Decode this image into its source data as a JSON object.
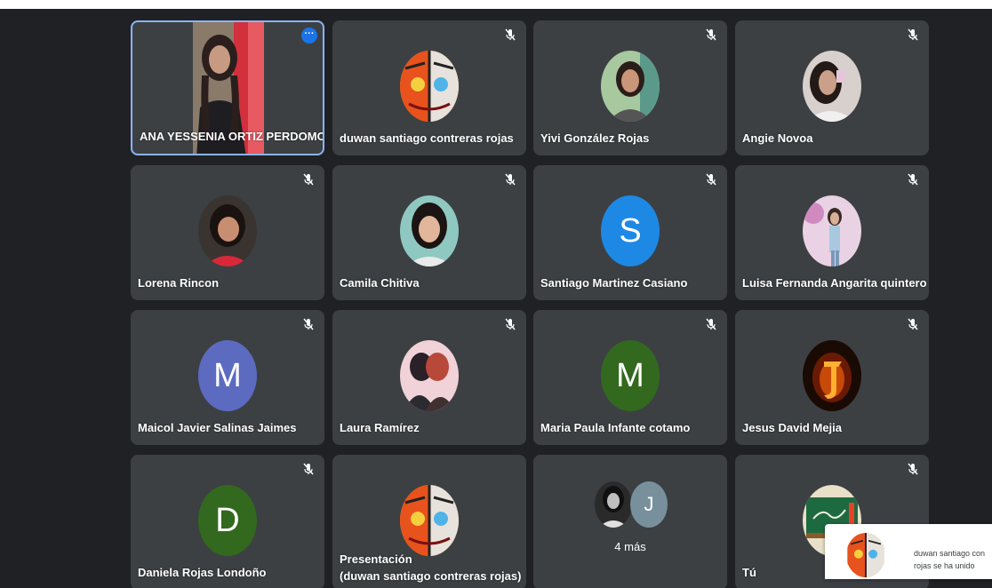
{
  "colors": {
    "background": "#202124",
    "tile": "#3c4043",
    "active_border": "#8ab4f8",
    "avatar_m_blue": "#5c6bc0",
    "avatar_s": "#1e88e5",
    "avatar_green": "#33691e",
    "avatar_j": "#78909c"
  },
  "participants": [
    {
      "name": "ANA YESSENIA ORTIZ PERDOMO",
      "muted": false,
      "active": true
    },
    {
      "name": "duwan santiago contreras rojas",
      "muted": true
    },
    {
      "name": "Yivi González Rojas",
      "muted": true
    },
    {
      "name": "Angie Novoa",
      "muted": true
    },
    {
      "name": "Lorena Rincon",
      "muted": true
    },
    {
      "name": "Camila Chitiva",
      "muted": true
    },
    {
      "name": "Santiago Martinez Casiano",
      "muted": true,
      "initial": "S"
    },
    {
      "name": "Luisa Fernanda Angarita quintero",
      "muted": true
    },
    {
      "name": "Maicol Javier Salinas Jaimes",
      "muted": true,
      "initial": "M"
    },
    {
      "name": "Laura Ramírez",
      "muted": true
    },
    {
      "name": "Maria Paula Infante cotamo",
      "muted": true,
      "initial": "M"
    },
    {
      "name": "Jesus David Mejia",
      "muted": true
    },
    {
      "name": "Daniela Rojas Londoño",
      "muted": true,
      "initial": "D"
    },
    {
      "name_line1": "Presentación",
      "name_line2": "(duwan santiago contreras rojas)"
    },
    {
      "more_label": "4 más",
      "initial": "J"
    },
    {
      "name": "Tú",
      "muted": true
    }
  ],
  "tile_menu": {
    "icon": "more-horiz-icon",
    "label": "···"
  },
  "toast": {
    "line1": "duwan santiago con",
    "line2": "rojas se ha unido"
  }
}
